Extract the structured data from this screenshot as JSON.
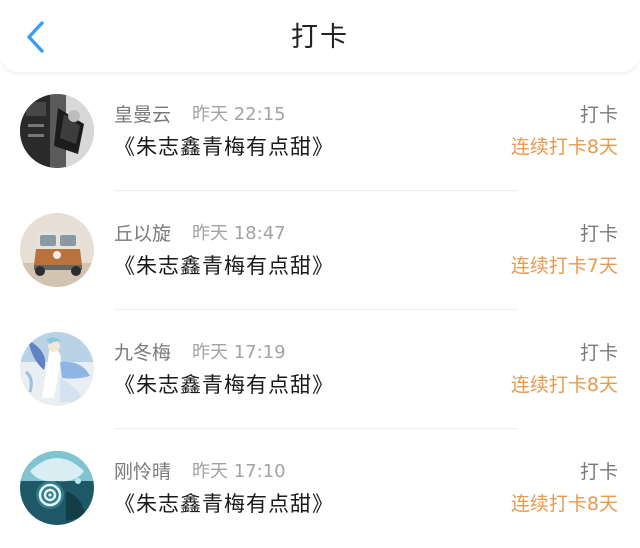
{
  "header": {
    "title": "打卡",
    "back_icon": "chevron-left-icon",
    "accent_color": "#3b9cf5"
  },
  "list": {
    "streak_color": "#e89a4f",
    "items": [
      {
        "name": "皇曼云",
        "time": "昨天 22:15",
        "book": "《朱志鑫青梅有点甜》",
        "action": "打卡",
        "streak": "连续打卡8天"
      },
      {
        "name": "丘以旋",
        "time": "昨天 18:47",
        "book": "《朱志鑫青梅有点甜》",
        "action": "打卡",
        "streak": "连续打卡7天"
      },
      {
        "name": "九冬梅",
        "time": "昨天 17:19",
        "book": "《朱志鑫青梅有点甜》",
        "action": "打卡",
        "streak": "连续打卡8天"
      },
      {
        "name": "刚怜晴",
        "time": "昨天 17:10",
        "book": "《朱志鑫青梅有点甜》",
        "action": "打卡",
        "streak": "连续打卡8天"
      }
    ]
  }
}
